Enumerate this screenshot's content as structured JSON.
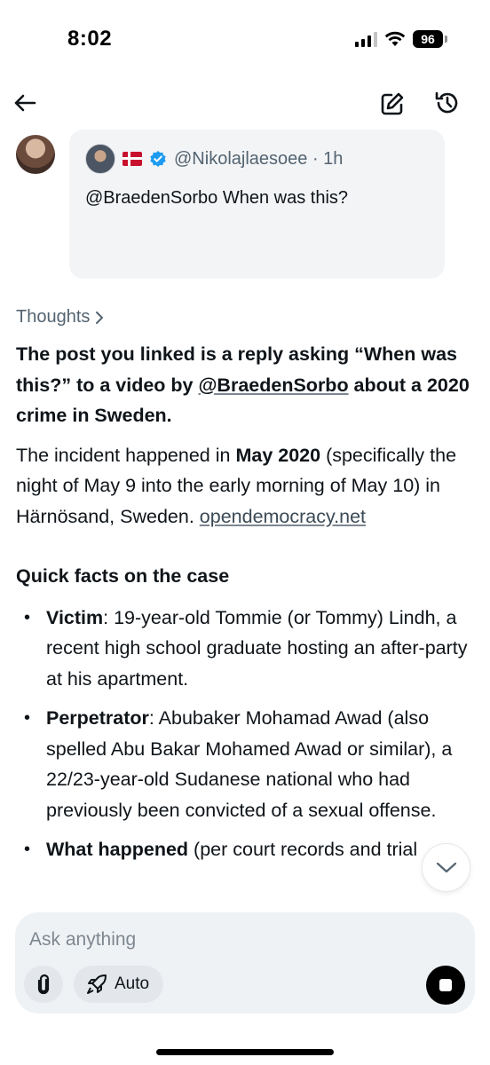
{
  "status_bar": {
    "time": "8:02",
    "battery": "96",
    "icons": [
      "cellular-signal-icon",
      "wifi-icon",
      "battery-icon"
    ]
  },
  "nav": {
    "icons": [
      "back-arrow-icon",
      "edit-compose-icon",
      "history-icon"
    ]
  },
  "post": {
    "handle": "@Nikolajlaesoee · 1h",
    "text": "@BraedenSorbo When was this?",
    "flag": "🇩🇰"
  },
  "thoughts": {
    "label": "Thoughts"
  },
  "answer": {
    "lead_pre": "The post you linked is a reply asking “When was this?” to a video by ",
    "lead_link": "@BraedenSorbo",
    "lead_post": " about a 2020 crime in Sweden.",
    "para_pre": "The incident happened in ",
    "para_bold": "May 2020",
    "para_post": " (specifically the night of May 9 into the early morning of May 10) in Härnösand, Sweden. ",
    "para_link": "opendemocracy.net",
    "section_title": "Quick facts on the case",
    "facts": [
      {
        "label": "Victim",
        "text": ": 19-year-old Tommie (or Tommy) Lindh, a recent high school graduate hosting an after-party at his apartment."
      },
      {
        "label": "Perpetrator",
        "text": ": Abubaker Mohamad Awad (also spelled Abu Bakar Mohamed Awad or similar), a 22/23-year-old Sudanese national who had previously been convicted of a sexual offense."
      },
      {
        "label": "What happened",
        "text": " (per court records and trial"
      }
    ]
  },
  "composer": {
    "placeholder": "Ask anything",
    "mode_label": "Auto"
  },
  "colors": {
    "text": "#0f1419",
    "muted": "#536471",
    "card_bg": "#f3f4f6",
    "verified": "#1d9bf0"
  }
}
